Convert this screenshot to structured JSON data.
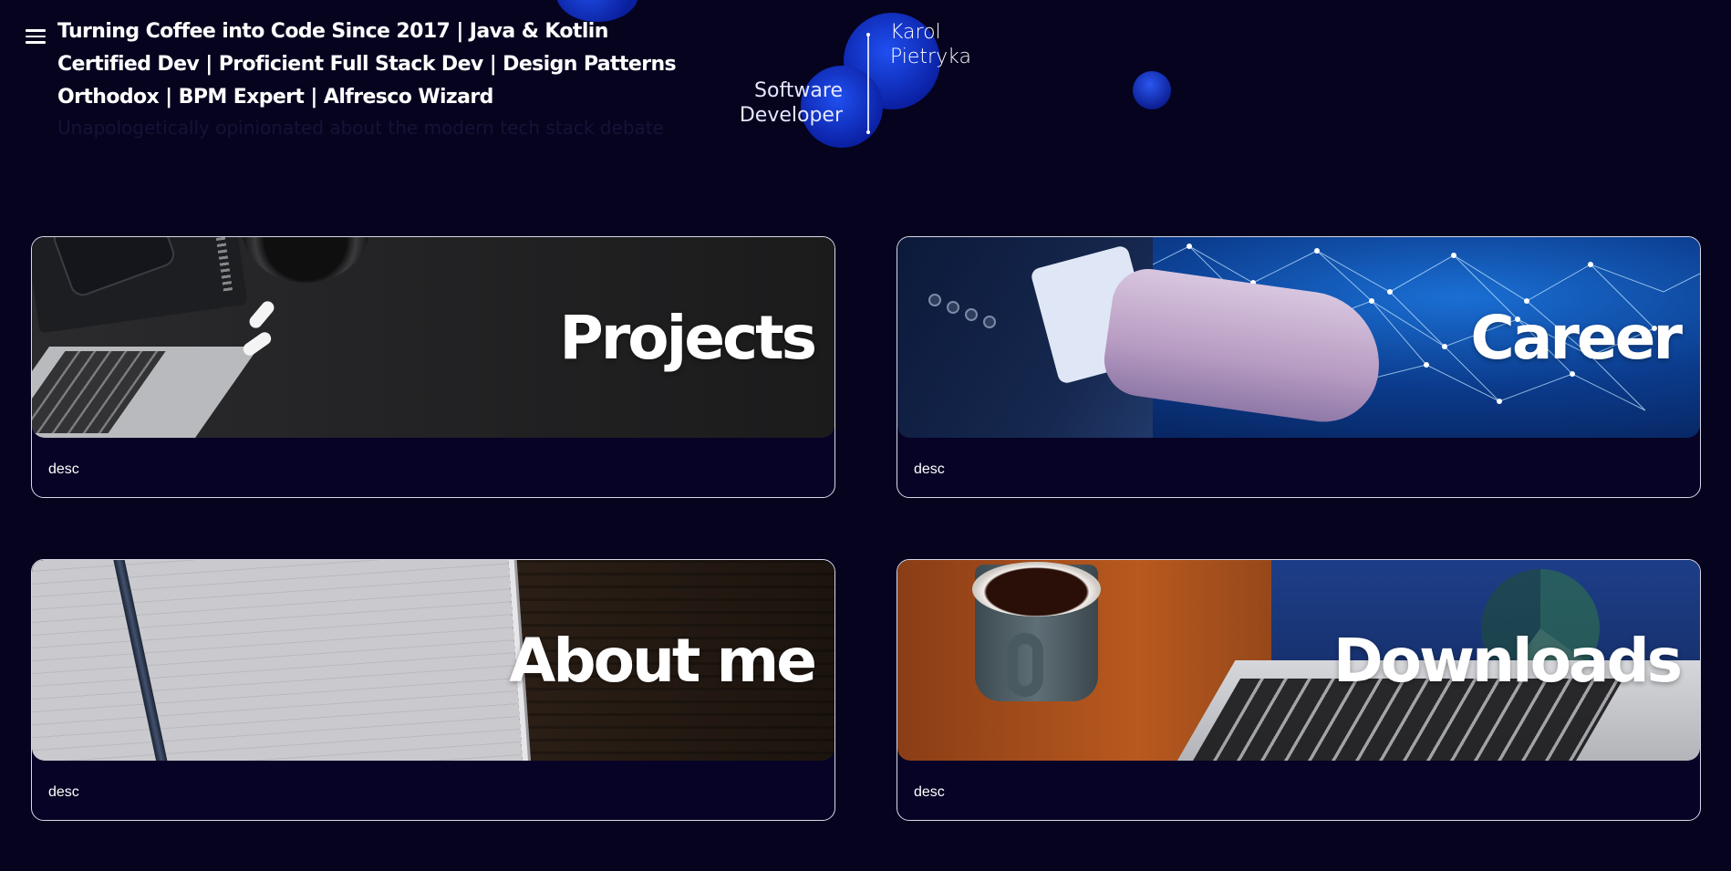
{
  "header": {
    "menu_icon": "hamburger-menu-icon",
    "tagline": "Turning Coffee into Code Since 2017 | Java & Kotlin Certified Dev | Proficient Full Stack Dev | Design Patterns Orthodox | BPM Expert | Alfresco Wizard",
    "tagline_faded": "Unapologetically opinionated about the modern tech stack debate"
  },
  "logo": {
    "name": "Karol Pietryka",
    "role": "Software Developer"
  },
  "cards": [
    {
      "title": "Projects",
      "desc": "desc"
    },
    {
      "title": "Career",
      "desc": "desc"
    },
    {
      "title": "About me",
      "desc": "desc"
    },
    {
      "title": "Downloads",
      "desc": "desc"
    }
  ],
  "colors": {
    "background": "#06031f",
    "card_footer": "#070326",
    "card_border": "#d8d8e8",
    "accent_orb": "#1f4de6"
  }
}
